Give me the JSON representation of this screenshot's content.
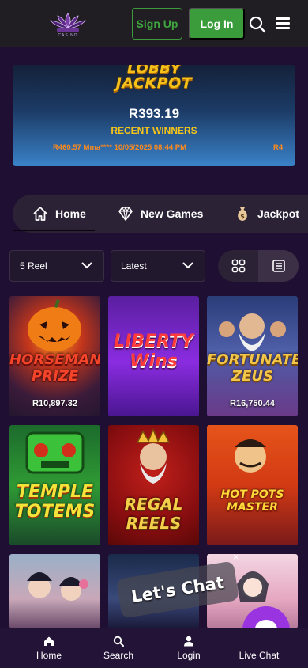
{
  "header": {
    "logo_subtext": "CASINO",
    "signup_label": "Sign Up",
    "login_label": "Log In"
  },
  "jackpot": {
    "logo_line1": "LOBBY",
    "logo_line2": "JACKPOT",
    "amount": "R393.19",
    "recent_label": "RECENT WINNERS",
    "ticker_1": "R460.57 Mma**** 10/05/2025 08:44 PM",
    "ticker_2": "R4"
  },
  "nav": {
    "items": [
      {
        "label": "Home",
        "icon": "house-icon"
      },
      {
        "label": "New Games",
        "icon": "diamond-icon"
      },
      {
        "label": "Jackpot",
        "icon": "money-bag-icon"
      }
    ]
  },
  "filters": {
    "reel_value": "5 Reel",
    "sort_value": "Latest"
  },
  "games": [
    {
      "title": "HORSEMAN'S PRIZE",
      "amount": "R10,897.32"
    },
    {
      "title": "LIBERTY Wins",
      "amount": ""
    },
    {
      "title": "FORTUNATE ZEUS",
      "amount": "R16,750.44"
    },
    {
      "title": "TEMPLE TOTEMS",
      "amount": ""
    },
    {
      "title": "REGAL REELS",
      "amount": ""
    },
    {
      "title": "HOT POTS MASTER",
      "amount": ""
    }
  ],
  "chat": {
    "bubble_text": "Let's Chat",
    "close_symbol": "×"
  },
  "bottom_nav": {
    "items": [
      {
        "label": "Home"
      },
      {
        "label": "Search"
      },
      {
        "label": "Login"
      },
      {
        "label": "Live Chat"
      }
    ]
  },
  "colors": {
    "background": "#1f0f33",
    "accent_green": "#3b9c3b",
    "jackpot_gold": "#f5c518",
    "ticker_orange": "#ff8a1c",
    "chat_purple": "#9a34e0"
  }
}
